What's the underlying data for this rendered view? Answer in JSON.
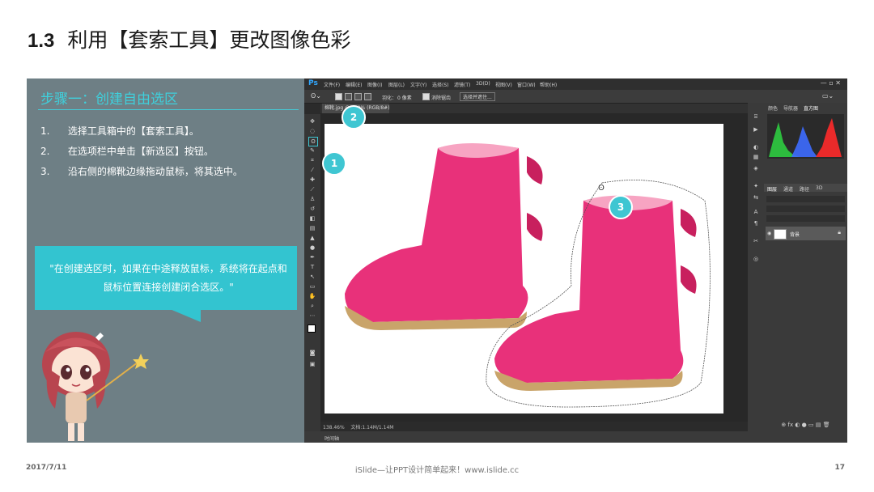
{
  "slide": {
    "section_number": "1.3",
    "title": "利用【套索工具】更改图像色彩"
  },
  "instructions": {
    "heading": "步骤一：创建自由选区",
    "steps": [
      {
        "num": "1.",
        "text": "选择工具箱中的【套索工具】。"
      },
      {
        "num": "2.",
        "text": "在选项栏中单击【新选区】按钮。"
      },
      {
        "num": "3.",
        "text": "沿右侧的棉靴边缘拖动鼠标，将其选中。"
      }
    ],
    "callout": "\"在创建选区时，如果在中途释放鼠标，系统将在起点和鼠标位置连接创建闭合选区。\""
  },
  "photoshop": {
    "logo": "Ps",
    "menu": [
      "文件(F)",
      "编辑(E)",
      "图像(I)",
      "图层(L)",
      "文字(Y)",
      "选择(S)",
      "滤镜(T)",
      "3D(D)",
      "视图(V)",
      "窗口(W)",
      "帮助(H)"
    ],
    "options": {
      "feather_label": "羽化：",
      "feather_value": "0 像素",
      "antialias_label": "消除锯齿",
      "select_mask_button": "选择并遮住..."
    },
    "doc_tab": "棉靴.jpg @ 100% (RGB/8#)",
    "status_zoom": "138.46%",
    "status_doc": "文档:1.14M/1.14M",
    "timeline_label": "时间轴",
    "panel_tabs_top": [
      "颜色",
      "导航器",
      "直方图"
    ],
    "panel_tabs_layers": [
      "图层",
      "通道",
      "路径",
      "3D"
    ],
    "layer_name": "背景",
    "histogram_colors": [
      "#2ecc40",
      "#3d6bff",
      "#ff2a2a"
    ]
  },
  "markers": [
    "1",
    "2",
    "3"
  ],
  "footer": {
    "date": "2017/7/11",
    "brand": "iSlide—让PPT设计简单起来！www.islide.cc",
    "page": "17"
  }
}
